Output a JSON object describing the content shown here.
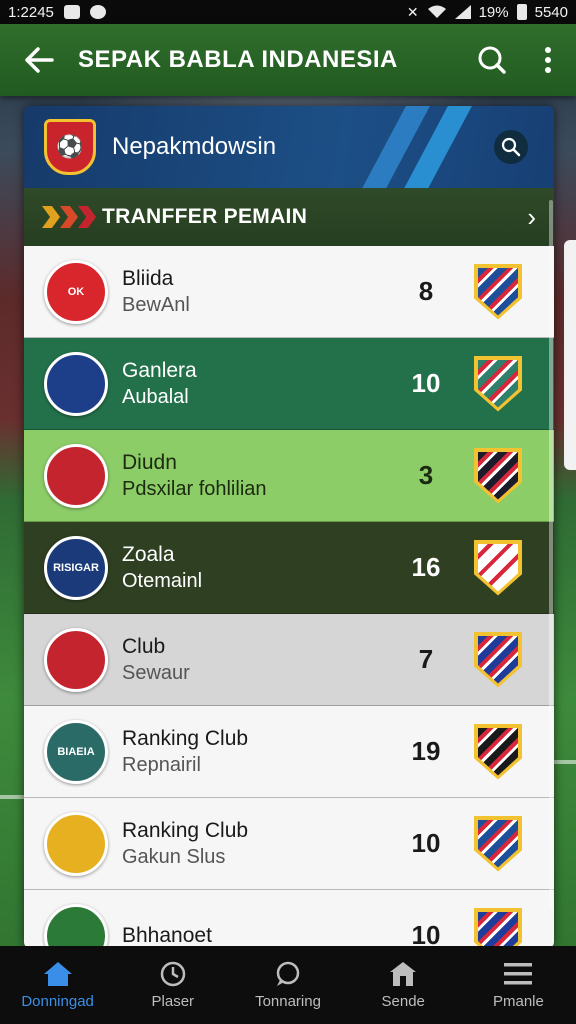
{
  "status_bar": {
    "time": "1:2245",
    "signal": "19%",
    "battery": "5540"
  },
  "app_bar": {
    "title": "SEPAK BABLA INDANESIA",
    "back_icon": "arrow-left-icon",
    "search_icon": "search-icon",
    "menu_icon": "more-vertical-icon"
  },
  "club_header": {
    "name": "Nepakmdowsin",
    "search_icon": "search-icon"
  },
  "section": {
    "label": "TRANFFER PEMAIN",
    "arrow": "›",
    "chevron_colors": [
      "#e0a21e",
      "#d8492a",
      "#c4242e"
    ]
  },
  "rows": [
    {
      "title": "Bliida",
      "subtitle": "BewAnl",
      "number": "8",
      "style": "light",
      "logo_color": "#d9262c",
      "logo_text": "OK",
      "shield_color": "#1f4f9a"
    },
    {
      "title": "Ganlera",
      "subtitle": "Aubalal",
      "number": "10",
      "style": "green",
      "logo_color": "#1d3f8a",
      "logo_text": "",
      "shield_color": "#2f7f6a"
    },
    {
      "title": "Diudn",
      "subtitle": "Pdsxilar fohlilian",
      "number": "3",
      "style": "lime",
      "logo_color": "#c4242e",
      "logo_text": "",
      "shield_color": "#1b1b2b"
    },
    {
      "title": "Zoala",
      "subtitle": "Otemainl",
      "number": "16",
      "style": "olive",
      "logo_color": "#1a3a7a",
      "logo_text": "RISIGAR",
      "shield_color": "#ffffff"
    },
    {
      "title": "Club",
      "subtitle": "Sewaur",
      "number": "7",
      "style": "grey",
      "logo_color": "#c4242e",
      "logo_text": "",
      "shield_color": "#1f3c9a"
    },
    {
      "title": "Ranking Club",
      "subtitle": "Repnairil",
      "number": "19",
      "style": "light",
      "logo_color": "#2a6b68",
      "logo_text": "BIAEIA",
      "shield_color": "#1a1a1a"
    },
    {
      "title": "Ranking Club",
      "subtitle": "Gakun Slus",
      "number": "10",
      "style": "light",
      "logo_color": "#e6b020",
      "logo_text": "",
      "shield_color": "#1d4f9a"
    },
    {
      "title": "Bhhanoet",
      "subtitle": "",
      "number": "10",
      "style": "light",
      "logo_color": "#2b7a38",
      "logo_text": "",
      "shield_color": "#1f3c9a"
    }
  ],
  "bottom_nav": [
    {
      "label": "Donningad",
      "icon": "home-icon",
      "active": true
    },
    {
      "label": "Plaser",
      "icon": "clock-icon",
      "active": false
    },
    {
      "label": "Tonnaring",
      "icon": "chat-icon",
      "active": false
    },
    {
      "label": "Sende",
      "icon": "building-icon",
      "active": false
    },
    {
      "label": "Pmanle",
      "icon": "menu-icon",
      "active": false
    }
  ]
}
